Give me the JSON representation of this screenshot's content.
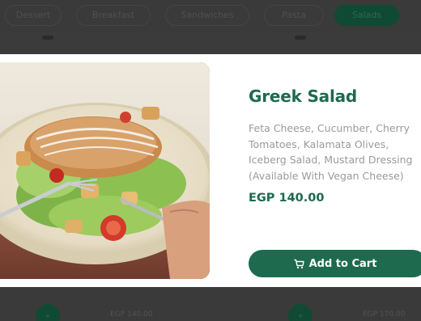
{
  "background": {
    "tabs": [
      "Dessert",
      "Breakfast",
      "Sandwiches",
      "Pasta",
      "Salads"
    ],
    "prices": [
      "EGP 140.00",
      "EGP 170.00"
    ],
    "badges": [
      "+",
      "+"
    ]
  },
  "modal": {
    "title": "Greek Salad",
    "description": "Feta Cheese, Cucumber, Cherry Tomatoes, Kalamata Olives, Iceberg Salad, Mustard Dressing (Available With Vegan Cheese)",
    "price": "EGP 140.00",
    "add_to_cart_label": "Add to Cart",
    "image_alt": "salad-photo"
  },
  "colors": {
    "brand_green": "#1d6a4f",
    "overlay": "#3b3b3b",
    "description_gray": "#9a9a9a"
  }
}
